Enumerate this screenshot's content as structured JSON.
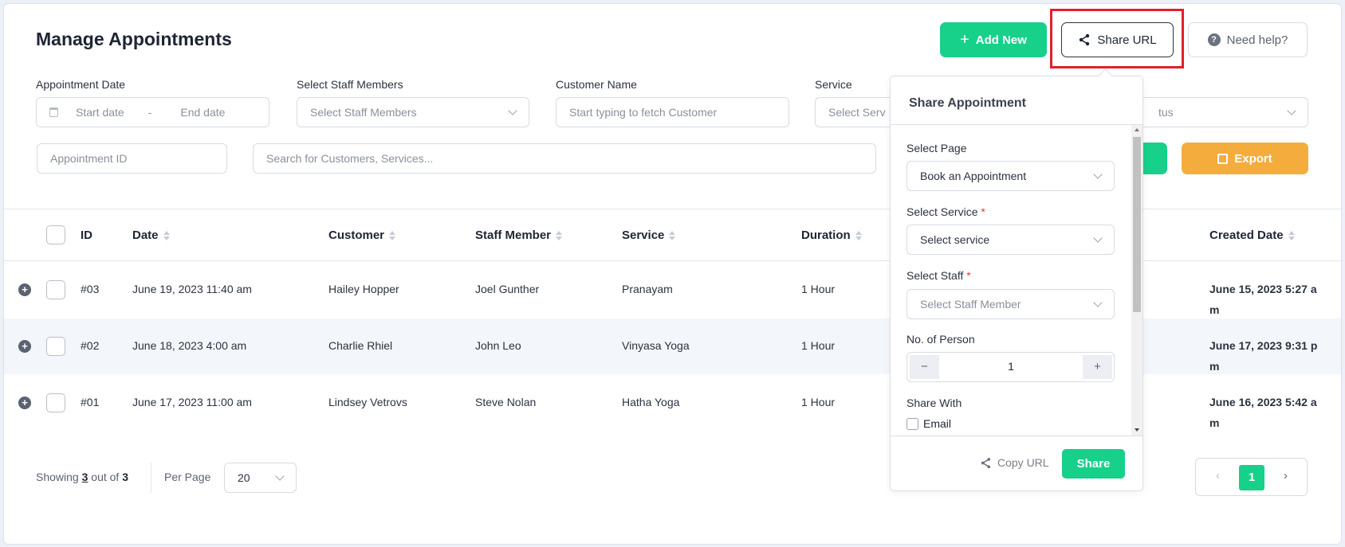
{
  "header": {
    "title": "Manage Appointments",
    "add_new": "Add New",
    "share_url": "Share URL",
    "need_help": "Need help?"
  },
  "filters": {
    "appointment_date_label": "Appointment Date",
    "start_date": "Start date",
    "date_sep": "-",
    "end_date": "End date",
    "staff_label": "Select Staff Members",
    "staff_placeholder": "Select Staff Members",
    "customer_label": "Customer Name",
    "customer_placeholder": "Start typing to fetch Customer",
    "service_label": "Service",
    "service_placeholder": "Select Serv",
    "status_placeholder": "tus",
    "appointment_id_placeholder": "Appointment ID",
    "search_placeholder": "Search for Customers, Services...",
    "export": "Export"
  },
  "table": {
    "columns": [
      "ID",
      "Date",
      "Customer",
      "Staff Member",
      "Service",
      "Duration",
      "Created Date"
    ],
    "rows": [
      {
        "id": "#03",
        "date": "June 19, 2023 11:40 am",
        "customer": "Hailey Hopper",
        "staff": "Joel Gunther",
        "service": "Pranayam",
        "duration": "1 Hour",
        "created": "June 15, 2023 5:27 a",
        "created2": "m"
      },
      {
        "id": "#02",
        "date": "June 18, 2023 4:00 am",
        "customer": "Charlie Rhiel",
        "staff": "John Leo",
        "service": "Vinyasa Yoga",
        "duration": "1 Hour",
        "created": "June 17, 2023 9:31 p",
        "created2": "m"
      },
      {
        "id": "#01",
        "date": "June 17, 2023 11:00 am",
        "customer": "Lindsey Vetrovs",
        "staff": "Steve Nolan",
        "service": "Hatha Yoga",
        "duration": "1 Hour",
        "created": "June 16, 2023 5:42 a",
        "created2": "m"
      }
    ]
  },
  "footer": {
    "showing_prefix": "Showing ",
    "showing_count": "3",
    "showing_suffix": " out of ",
    "total": "3",
    "per_page_label": "Per Page",
    "per_page_value": "20",
    "current_page": "1",
    "prev": "‹",
    "next": "›"
  },
  "popover": {
    "title": "Share Appointment",
    "select_page_label": "Select Page",
    "select_page_value": "Book an Appointment",
    "select_service_label": "Select Service",
    "select_service_placeholder": "Select service",
    "select_staff_label": "Select Staff",
    "select_staff_placeholder": "Select Staff Member",
    "persons_label": "No. of Person",
    "persons_value": "1",
    "minus": "−",
    "plus": "+",
    "share_with_label": "Share With",
    "email_option": "Email",
    "required_mark": "*",
    "copy_url": "Copy URL",
    "share": "Share"
  },
  "colors": {
    "accent": "#17d08a",
    "export": "#f4ad3d",
    "highlight": "#e32028"
  }
}
